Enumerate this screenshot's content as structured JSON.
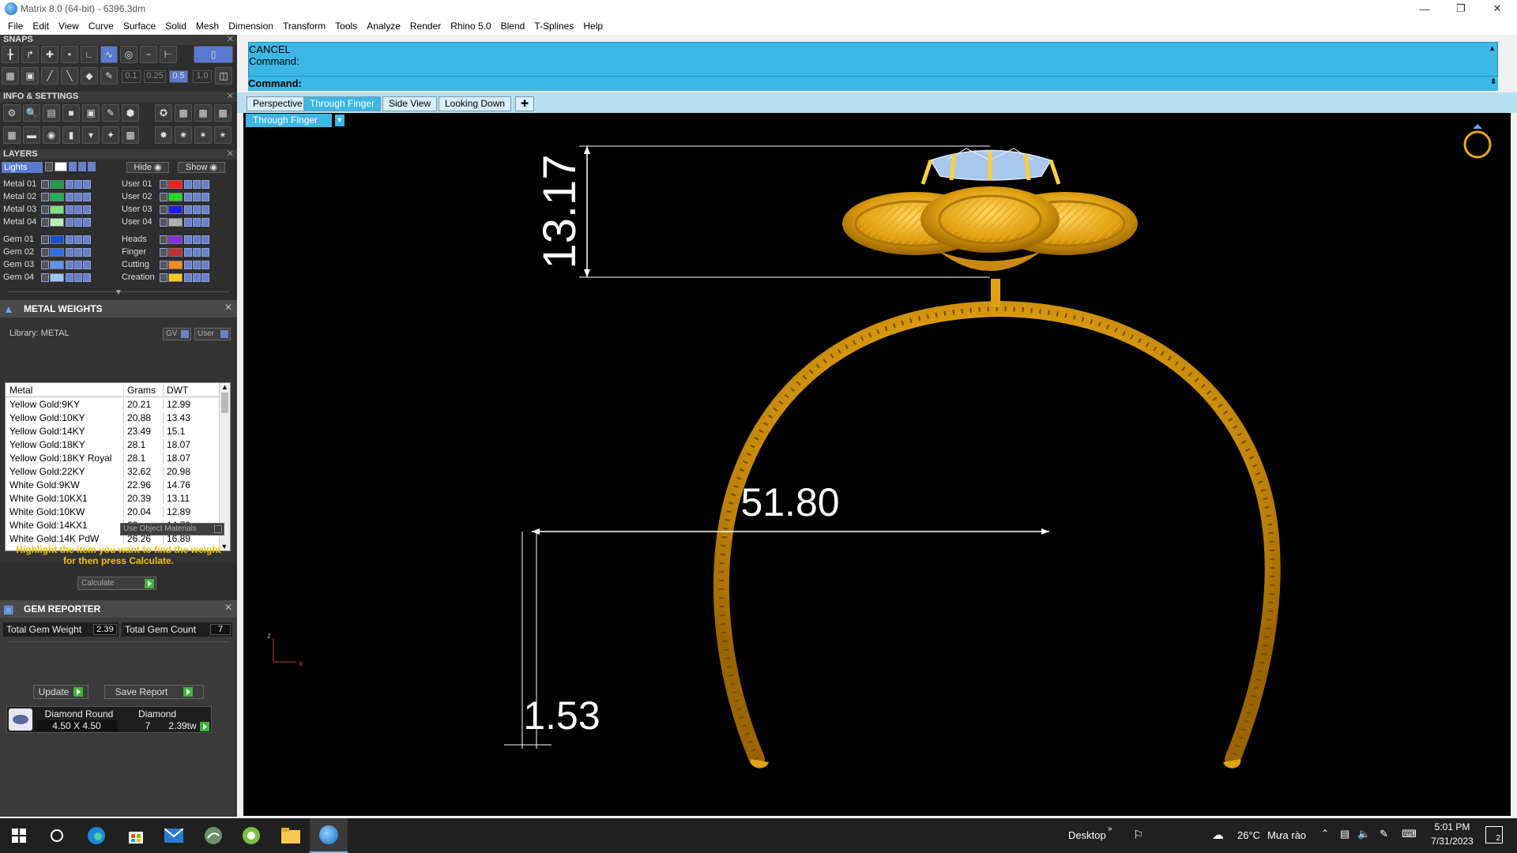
{
  "window": {
    "title": "Matrix 8.0 (64-bit) - 6396.3dm"
  },
  "menu": [
    "File",
    "Edit",
    "View",
    "Curve",
    "Surface",
    "Solid",
    "Mesh",
    "Dimension",
    "Transform",
    "Tools",
    "Analyze",
    "Render",
    "Rhino 5.0",
    "Blend",
    "T-Splines",
    "Help"
  ],
  "snaps": {
    "title": "SNAPS",
    "values": [
      "0.1",
      "0.25",
      "0.5",
      "1.0"
    ]
  },
  "info": {
    "title": "INFO & SETTINGS"
  },
  "layers": {
    "title": "LAYERS",
    "lights": "Lights",
    "hide": "Hide",
    "show": "Show",
    "left": [
      {
        "name": "Metal 01",
        "color": "#1f9a4a"
      },
      {
        "name": "Metal 02",
        "color": "#22b050"
      },
      {
        "name": "Metal 03",
        "color": "#7fe07f"
      },
      {
        "name": "Metal 04",
        "color": "#b8f0b0"
      },
      {
        "name": "Gem 01",
        "color": "#1a4fd0"
      },
      {
        "name": "Gem 02",
        "color": "#2f6fe6"
      },
      {
        "name": "Gem 03",
        "color": "#5a94f4"
      },
      {
        "name": "Gem 04",
        "color": "#9cc4fa"
      }
    ],
    "right": [
      {
        "name": "User 01",
        "color": "#ff1a1a"
      },
      {
        "name": "User 02",
        "color": "#1ae01a"
      },
      {
        "name": "User 03",
        "color": "#1a1aff"
      },
      {
        "name": "User 04",
        "color": "#b0b0b0"
      },
      {
        "name": "Heads",
        "color": "#8a2be2"
      },
      {
        "name": "Finger",
        "color": "#c03030"
      },
      {
        "name": "Cutting",
        "color": "#ff8c1a"
      },
      {
        "name": "Creation",
        "color": "#ffc81a"
      }
    ]
  },
  "metal_weights": {
    "title": "METAL WEIGHTS",
    "library": "Library: METAL",
    "gv": "GV",
    "user": "User",
    "columns": [
      "Metal",
      "Grams",
      "DWT"
    ],
    "rows": [
      [
        "Yellow Gold:9KY",
        "20.21",
        "12.99"
      ],
      [
        "Yellow Gold:10KY",
        "20.88",
        "13.43"
      ],
      [
        "Yellow Gold:14KY",
        "23.49",
        "15.1"
      ],
      [
        "Yellow Gold:18KY",
        "28.1",
        "18.07"
      ],
      [
        "Yellow Gold:18KY Royal",
        "28.1",
        "18.07"
      ],
      [
        "Yellow Gold:22KY",
        "32.62",
        "20.98"
      ],
      [
        "White Gold:9KW",
        "22.96",
        "14.76"
      ],
      [
        "White Gold:10KX1",
        "20.39",
        "13.11"
      ],
      [
        "White Gold:10KW",
        "20.04",
        "12.89"
      ],
      [
        "White Gold:14KX1",
        "23",
        "14.79"
      ],
      [
        "White Gold:14K PdW",
        "26.26",
        "16.89"
      ]
    ],
    "use_object_materials": "Use Object Materials",
    "hint": "Highlight the item you want to find the weight for then press Calculate.",
    "calculate": "Calculate"
  },
  "gem_reporter": {
    "title": "GEM REPORTER",
    "total_weight_label": "Total Gem Weight",
    "total_weight": "2.39",
    "total_count_label": "Total Gem Count",
    "total_count": "7",
    "update": "Update",
    "save_report": "Save Report",
    "gem": {
      "shape": "Diamond Round",
      "material": "Diamond",
      "size": "4.50 X 4.50",
      "count": "7",
      "weight": "2.39tw"
    }
  },
  "command": {
    "line1": "CANCEL",
    "line2": "Command:",
    "line3": "Command:"
  },
  "view_tabs": [
    "Perspective",
    "Through Finger",
    "Side View",
    "Looking Down"
  ],
  "active_tab": "Through Finger",
  "viewport_label": "Through Finger",
  "dimensions": {
    "height": "13.17",
    "diameter": "51.80",
    "thickness": "1.53"
  },
  "axis": {
    "z": "z",
    "x": "x"
  },
  "colors": {
    "accent": "#3cb8e6",
    "gold": "#e8a81a",
    "dim_line": "#ffffff"
  },
  "taskbar": {
    "desktop": "Desktop",
    "temperature": "26°C",
    "weather": "Mưa rào",
    "time": "5:01 PM",
    "date": "7/31/2023",
    "notifications": "2"
  }
}
